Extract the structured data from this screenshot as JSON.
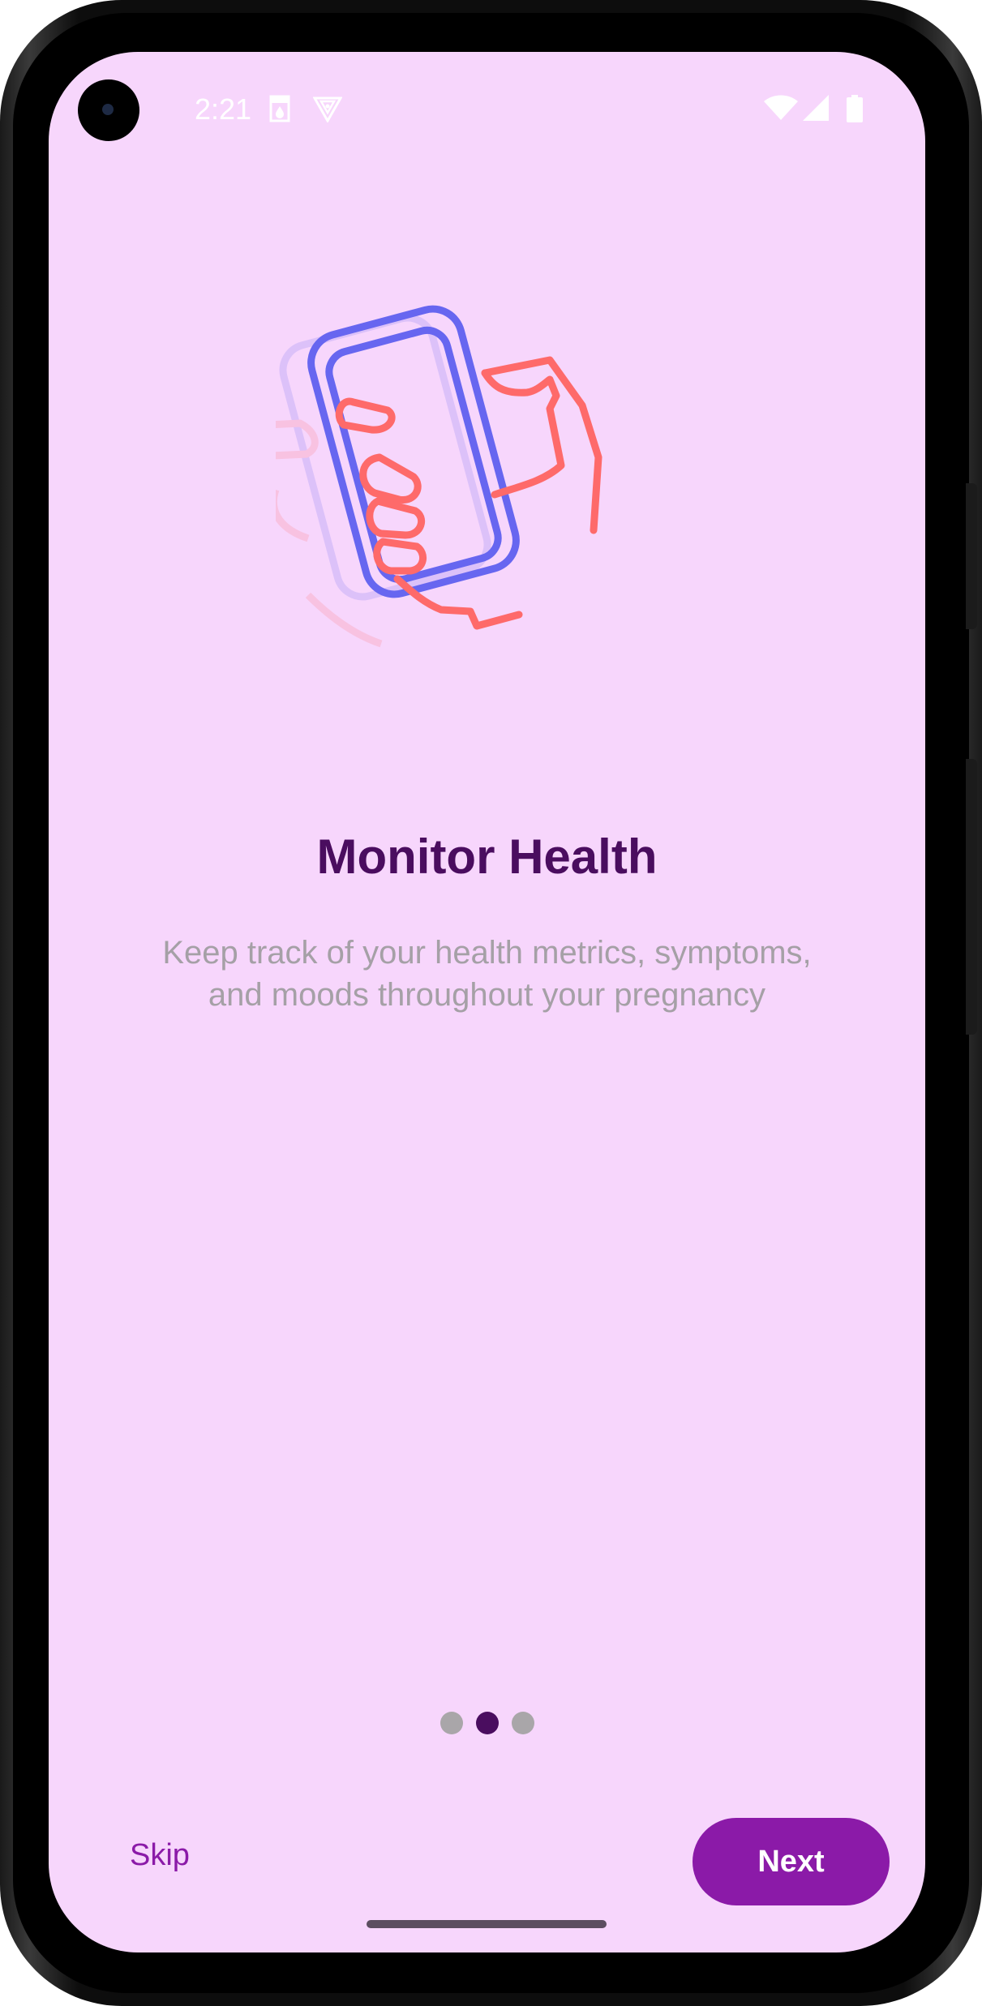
{
  "status_bar": {
    "time": "2:21",
    "left_icons": [
      "sim-card-icon",
      "shield-icon"
    ],
    "right_icons": [
      "wifi-icon",
      "cellular-signal-icon",
      "battery-icon"
    ]
  },
  "onboarding": {
    "illustration": "hand-holding-phone-icon",
    "title": "Monitor Health",
    "subtitle_line1": "Keep track of your health metrics, symptoms,",
    "subtitle_line2": "and moods throughout your pregnancy",
    "page_indicator": {
      "total": 3,
      "current": 2
    }
  },
  "actions": {
    "skip_label": "Skip",
    "next_label": "Next"
  },
  "colors": {
    "background": "#f7d6fc",
    "title": "#4a0d5f",
    "subtitle": "#a5a0a6",
    "accent": "#8b1aa8",
    "dot_inactive": "#a9a6a9",
    "dot_active": "#4a0d5f",
    "illustration_phone": "#6766f0",
    "illustration_hand": "#fe6a6a"
  }
}
